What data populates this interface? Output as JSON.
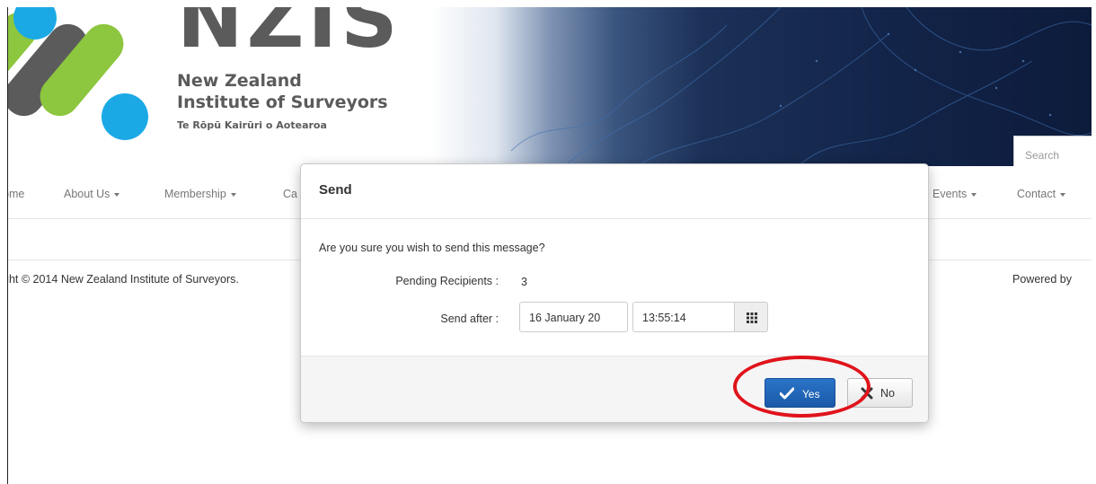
{
  "header": {
    "logo_text": "NZIS",
    "org_name_line1": "New Zealand",
    "org_name_line2": "Institute of Surveyors",
    "org_name_maori": "Te Rōpū Kairūri o Aotearoa",
    "search_placeholder": "Search"
  },
  "nav": {
    "items": [
      {
        "label": "ome"
      },
      {
        "label": "About Us"
      },
      {
        "label": "Membership"
      },
      {
        "label": "Ca"
      },
      {
        "label": "Events"
      },
      {
        "label": "Contact"
      }
    ]
  },
  "footer": {
    "copyright": "ght © 2014 New Zealand Institute of Surveyors.",
    "powered": "Powered by"
  },
  "modal": {
    "title": "Send",
    "question": "Are you sure you wish to send this message?",
    "pending_label": "Pending Recipients :",
    "pending_value": "3",
    "send_after_label": "Send after :",
    "send_after_date": "16 January 20",
    "send_after_time": "13:55:14",
    "yes_label": "Yes",
    "no_label": "No"
  },
  "colors": {
    "accent_blue": "#1a5aa8",
    "highlight_red": "#e0131b",
    "logo_green": "#8dc63f",
    "logo_cyan": "#1ba9e6",
    "logo_grey": "#5b5b5c"
  }
}
